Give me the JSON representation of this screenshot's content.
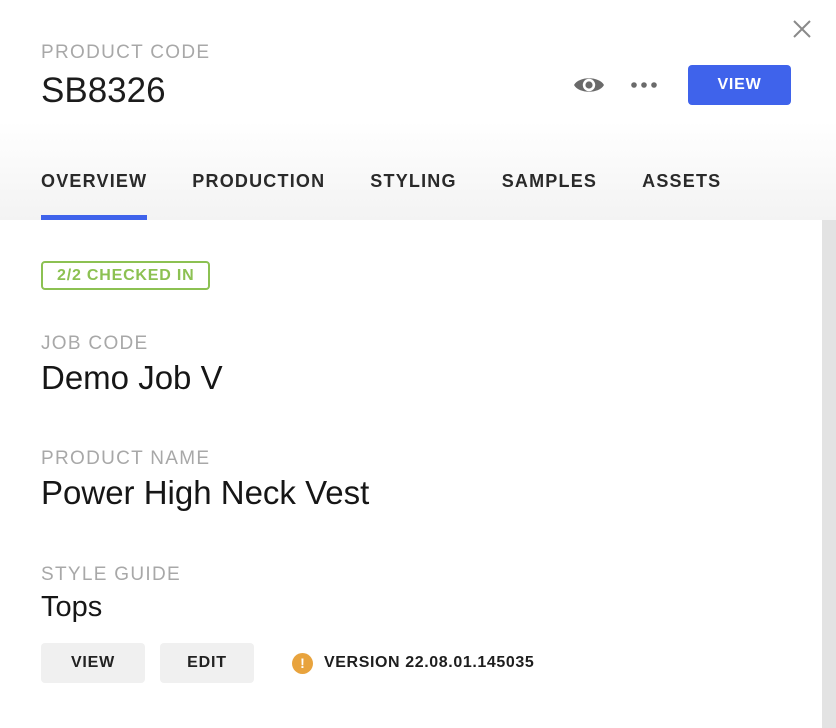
{
  "header": {
    "code_label": "PRODUCT CODE",
    "code_value": "SB8326",
    "view_label": "VIEW",
    "icons": {
      "close": "close-icon",
      "eye": "eye-icon",
      "more": "more-horizontal-icon"
    }
  },
  "tabs": [
    {
      "label": "OVERVIEW",
      "active": true
    },
    {
      "label": "PRODUCTION",
      "active": false
    },
    {
      "label": "STYLING",
      "active": false
    },
    {
      "label": "SAMPLES",
      "active": false
    },
    {
      "label": "ASSETS",
      "active": false
    }
  ],
  "overview": {
    "status_badge": "2/2 CHECKED IN",
    "job_code_label": "JOB CODE",
    "job_code_value": "Demo Job V",
    "product_name_label": "PRODUCT NAME",
    "product_name_value": "Power High Neck Vest",
    "style_guide_label": "STYLE GUIDE",
    "style_guide_value": "Tops",
    "view_button": "VIEW",
    "edit_button": "EDIT",
    "version_icon": "!",
    "version_text": "VERSION 22.08.01.145035"
  },
  "colors": {
    "accent": "#3f63eb",
    "badge": "#8cc152",
    "warning": "#e8a33d",
    "label": "#a8a8a8"
  }
}
